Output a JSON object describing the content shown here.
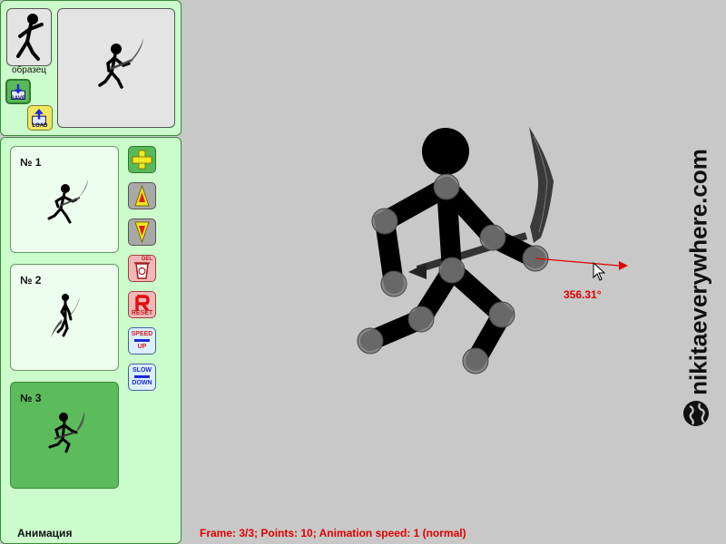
{
  "sample": {
    "label": "образец"
  },
  "io": {
    "save_label": "SAVE",
    "load_label": "LOAD"
  },
  "frames": [
    {
      "label": "№ 1",
      "selected": false
    },
    {
      "label": "№ 2",
      "selected": false
    },
    {
      "label": "№ 3",
      "selected": true
    }
  ],
  "tools": {
    "add": "add-frame",
    "move_up": "move-frame-up",
    "move_down": "move-frame-down",
    "delete_caption": "DEL",
    "reset_caption": "RESET",
    "speed_up_caption_1": "SPEED",
    "speed_up_caption_2": "UP",
    "slow_down_caption_1": "SLOW",
    "slow_down_caption_2": "DOWN"
  },
  "panel_title": "Анимация",
  "status": "Frame: 3/3; Points: 10; Animation speed: 1 (normal)",
  "angle_readout": "356.31°",
  "watermark": "nikitaeverywhere.com",
  "colors": {
    "panel_bg": "#ccfccc",
    "selected_frame": "#5cbc5c",
    "status_red": "#e00000",
    "canvas_bg": "#c8c8c8"
  }
}
